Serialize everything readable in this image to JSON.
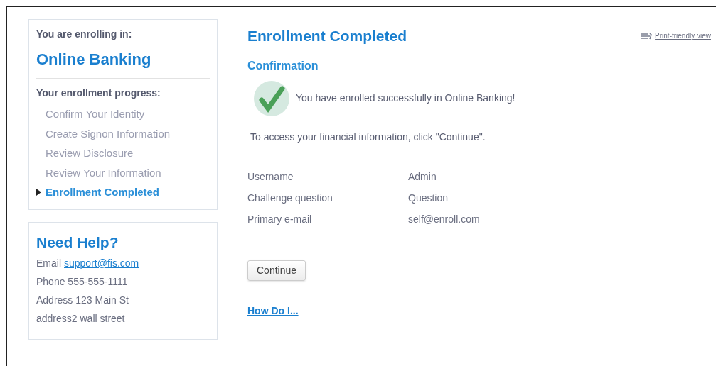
{
  "sidebar": {
    "enrolling_label": "You are enrolling in:",
    "product": "Online Banking",
    "progress_label": "Your enrollment progress:",
    "steps": [
      {
        "label": "Confirm Your Identity",
        "selected": false
      },
      {
        "label": "Create Signon Information",
        "selected": false
      },
      {
        "label": "Review Disclosure",
        "selected": false
      },
      {
        "label": "Review Your Information",
        "selected": false
      },
      {
        "label": "Enrollment Completed",
        "selected": true
      }
    ]
  },
  "help": {
    "title": "Need Help?",
    "email_label": "Email",
    "email_link": "support@fis.com",
    "lines": [
      "Phone 555-555-1111",
      "Address 123 Main St",
      "address2 wall street"
    ]
  },
  "main": {
    "title": "Enrollment Completed",
    "print_link": "Print-friendly view",
    "subtitle": "Confirmation",
    "success": "You have enrolled successfully in Online Banking!",
    "instruction": "To access your financial information, click \"Continue\".",
    "details": [
      {
        "label": "Username",
        "value": "Admin"
      },
      {
        "label": "Challenge question",
        "value": "Question"
      },
      {
        "label": "Primary e-mail",
        "value": "self@enroll.com"
      }
    ],
    "button": "Continue",
    "help_link": "How Do I..."
  }
}
